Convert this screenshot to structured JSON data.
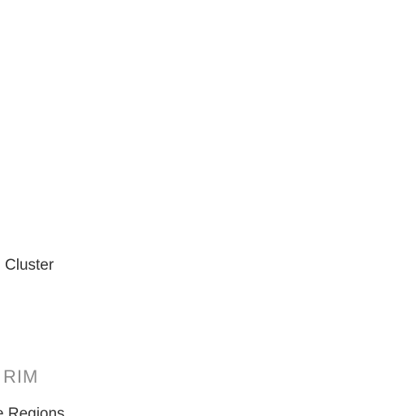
{
  "menu": {
    "cluster_label": "Cluster",
    "section_heading": "RIM",
    "regions_label": "e Regions"
  },
  "colors": {
    "background": "#ffffff",
    "item_text": "#333333",
    "heading_text": "#8a8a8a"
  }
}
